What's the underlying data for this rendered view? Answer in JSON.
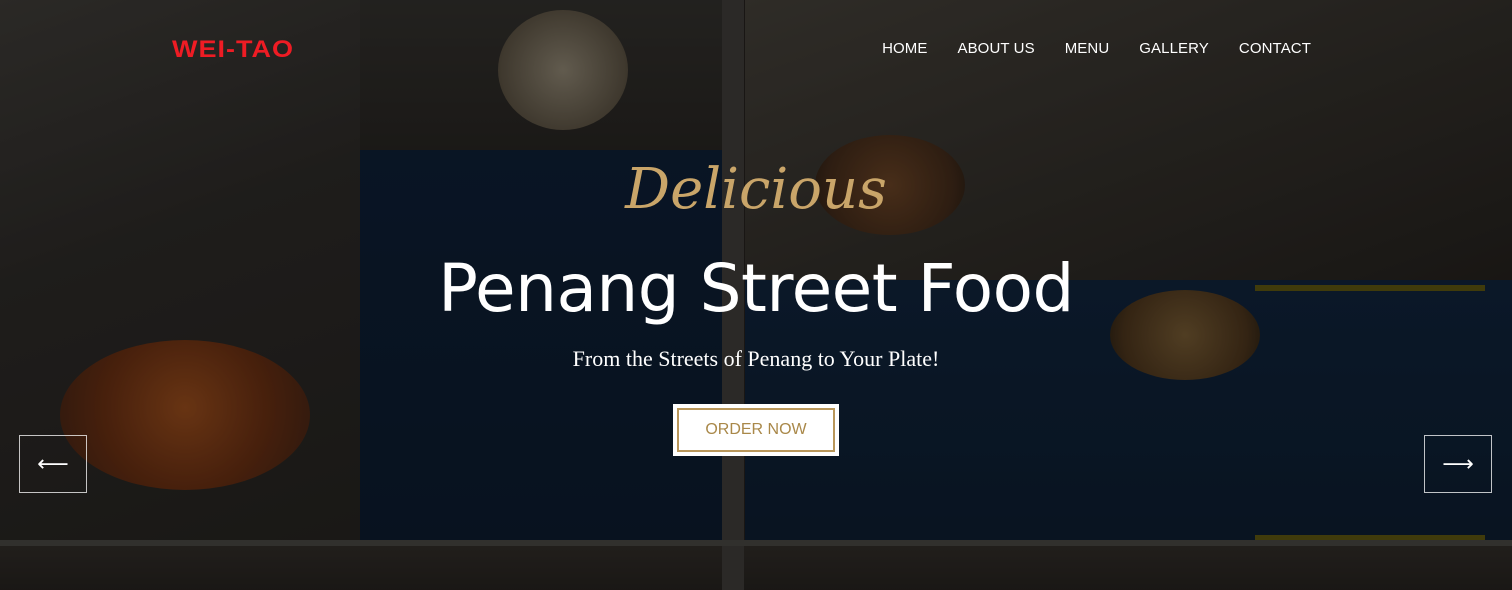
{
  "brand": {
    "logo_text": "WEI-TAO",
    "logo_color": "#ee1c24"
  },
  "nav": {
    "items": [
      {
        "label": "HOME"
      },
      {
        "label": "ABOUT US"
      },
      {
        "label": "MENU"
      },
      {
        "label": "GALLERY"
      },
      {
        "label": "CONTACT"
      }
    ]
  },
  "hero": {
    "script_title": "Delicious",
    "title": "Penang Street Food",
    "subtitle": "From the Streets of Penang to Your Plate!",
    "cta_label": "ORDER NOW",
    "accent_color": "#c9a569"
  },
  "carousel": {
    "prev_icon": "arrow-left-icon",
    "next_icon": "arrow-right-icon",
    "prev_glyph": "⟵",
    "next_glyph": "⟶"
  }
}
